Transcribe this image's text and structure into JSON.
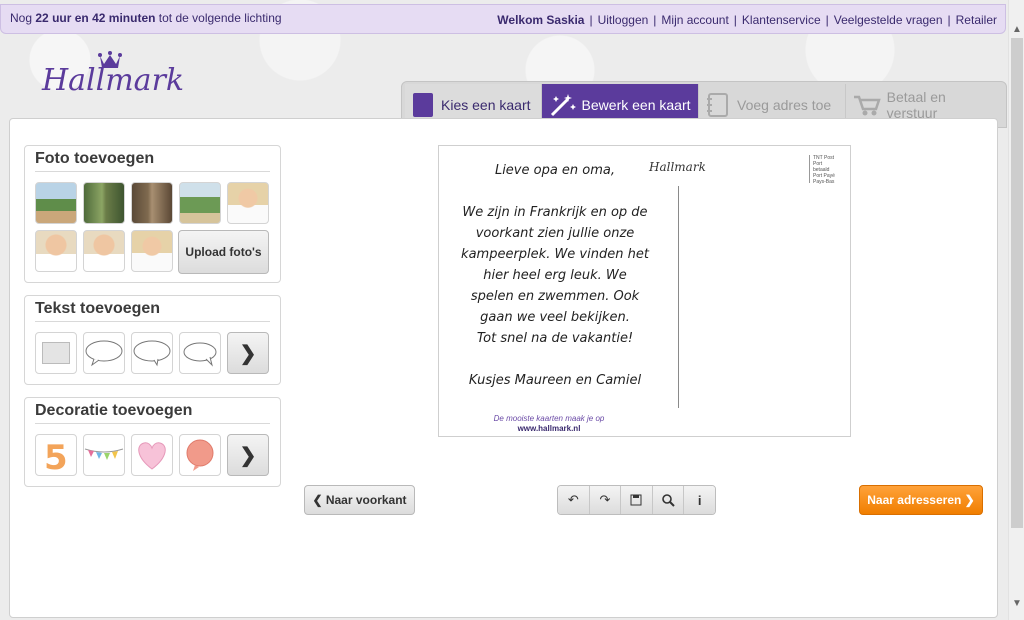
{
  "topbar": {
    "countdown_prefix": "Nog",
    "hours": "22",
    "hours_unit": "uur en",
    "minutes": "42",
    "minutes_unit": "minuten",
    "countdown_suffix": "tot de volgende lichting",
    "welcome": "Welkom Saskia",
    "links": [
      "Uitloggen",
      "Mijn account",
      "Klantenservice",
      "Veelgestelde vragen",
      "Retailer"
    ]
  },
  "logo": {
    "text": "Hallmark"
  },
  "steps": [
    {
      "label": "Kies een kaart",
      "icon": "card-icon",
      "state": "done"
    },
    {
      "label": "Bewerk een kaart",
      "icon": "magic-wand-icon",
      "state": "active"
    },
    {
      "label": "Voeg adres toe",
      "icon": "address-book-icon",
      "state": "disabled"
    },
    {
      "label": "Betaal en verstuur",
      "icon": "cart-icon",
      "state": "disabled"
    }
  ],
  "photos": {
    "title": "Foto toevoegen",
    "upload_label": "Upload foto's"
  },
  "text_section": {
    "title": "Tekst toevoegen"
  },
  "decoration_section": {
    "title": "Decoratie toevoegen"
  },
  "card": {
    "greeting": "Lieve opa en oma,",
    "body": [
      "We zijn in Frankrijk en op de",
      "voorkant zien jullie onze",
      "kampeerplek. We vinden het",
      "hier heel erg leuk. We",
      "spelen en zwemmen. Ook",
      "gaan we veel bekijken.",
      "Tot snel na de vakantie!"
    ],
    "signature": "Kusjes Maureen en Camiel",
    "brand": "Hallmark",
    "tagline": "De mooiste kaarten maak je op",
    "url": "www.hallmark.nl",
    "stamp_lines": [
      "TNT Post",
      "Port betaald",
      "Port Payé",
      "Pays-Bas"
    ]
  },
  "bottom": {
    "prev_label": "Naar voorkant",
    "next_label": "Naar adresseren",
    "tools": [
      "undo-icon",
      "redo-icon",
      "save-icon",
      "zoom-icon",
      "info-icon"
    ]
  },
  "colors": {
    "brand_purple": "#5b3b9c",
    "topbar_bg": "#e6dcf3",
    "next_orange": "#f07e00"
  }
}
